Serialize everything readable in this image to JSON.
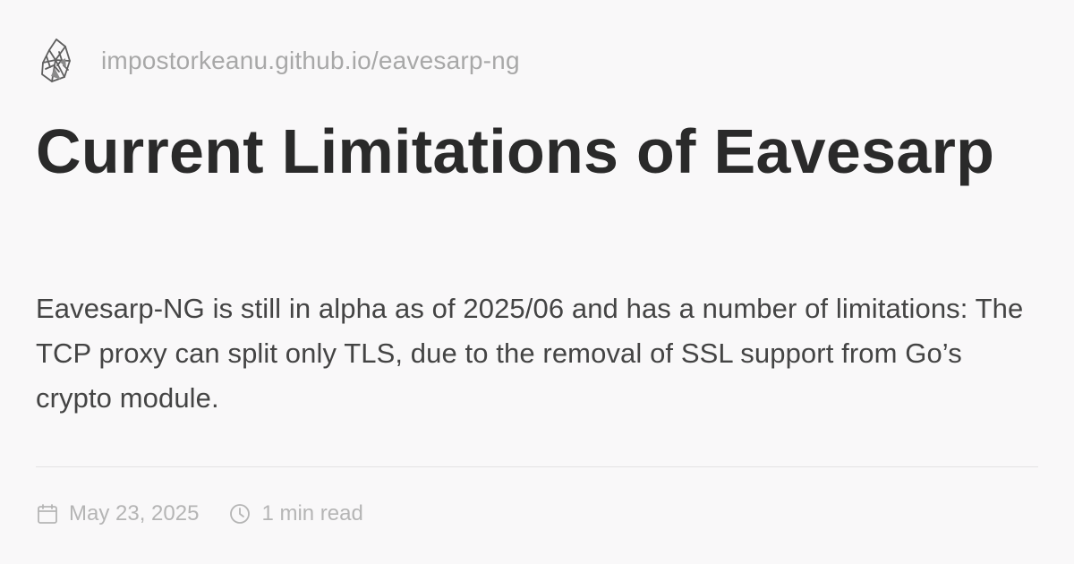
{
  "site": {
    "logo_icon": "crystal-logo-icon",
    "url": "impostorkeanu.github.io/eavesarp-ng"
  },
  "post": {
    "title": "Current Limitations of Eavesarp",
    "description": "Eavesarp-NG is still in alpha as of 2025/06 and has a number of limitations: The TCP proxy can split only TLS, due to the removal of SSL support from Go’s crypto module."
  },
  "meta": {
    "date_icon": "calendar-icon",
    "date": "May 23, 2025",
    "read_time_icon": "clock-icon",
    "read_time": "1 min read"
  },
  "colors": {
    "background": "#f9f8f9",
    "title": "#2a2a2a",
    "body_text": "#444444",
    "muted_text": "#a8a8a8",
    "divider": "#e3e2e3"
  }
}
